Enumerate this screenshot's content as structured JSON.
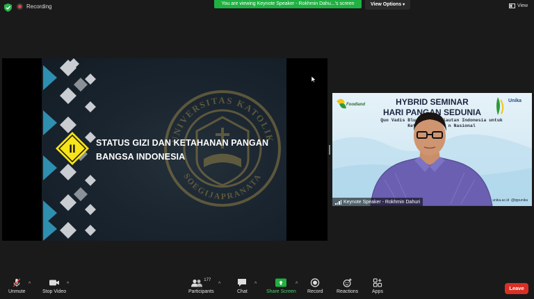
{
  "top": {
    "recording_label": "Recording",
    "viewing_banner": "You are viewing Keynote Speaker - Rokhmin Dahu...'s screen",
    "view_options_label": "View Options",
    "view_label": "View"
  },
  "slide": {
    "badge_text": "II",
    "title_line1": "STATUS GIZI DAN KETAHANAN PANGAN",
    "title_line2": "BANGSA INDONESIA",
    "seal_text_top": "UNIVERSITAS KATOLIK",
    "seal_text_bottom": "SOEGIJAPRANATA"
  },
  "video": {
    "banner_line1": "HYBRID SEMINAR",
    "banner_line2": "HARI PANGAN SEDUNIA",
    "banner_sub1": "Quo Vadis Blue Ec      lautan Indonesia untuk",
    "banner_sub2": "Ketah          n Nasional",
    "logo_left": "Foodland",
    "logo_right": "Unika",
    "participant_name": "Keynote Speaker - Rokhmin Dahuri",
    "footer_left": "unika.ac.id",
    "footer_right": "@tppunika"
  },
  "toolbar": {
    "unmute": "Unmute",
    "stop_video": "Stop Video",
    "participants": "Participants",
    "participants_count": "177",
    "chat": "Chat",
    "share_screen": "Share Screen",
    "record": "Record",
    "reactions": "Reactions",
    "apps": "Apps",
    "leave": "Leave"
  },
  "colors": {
    "share_green": "#1fb141",
    "leave_red": "#d93025",
    "badge_yellow": "#f6e319",
    "diamond_teal": "#2e8fb0"
  }
}
